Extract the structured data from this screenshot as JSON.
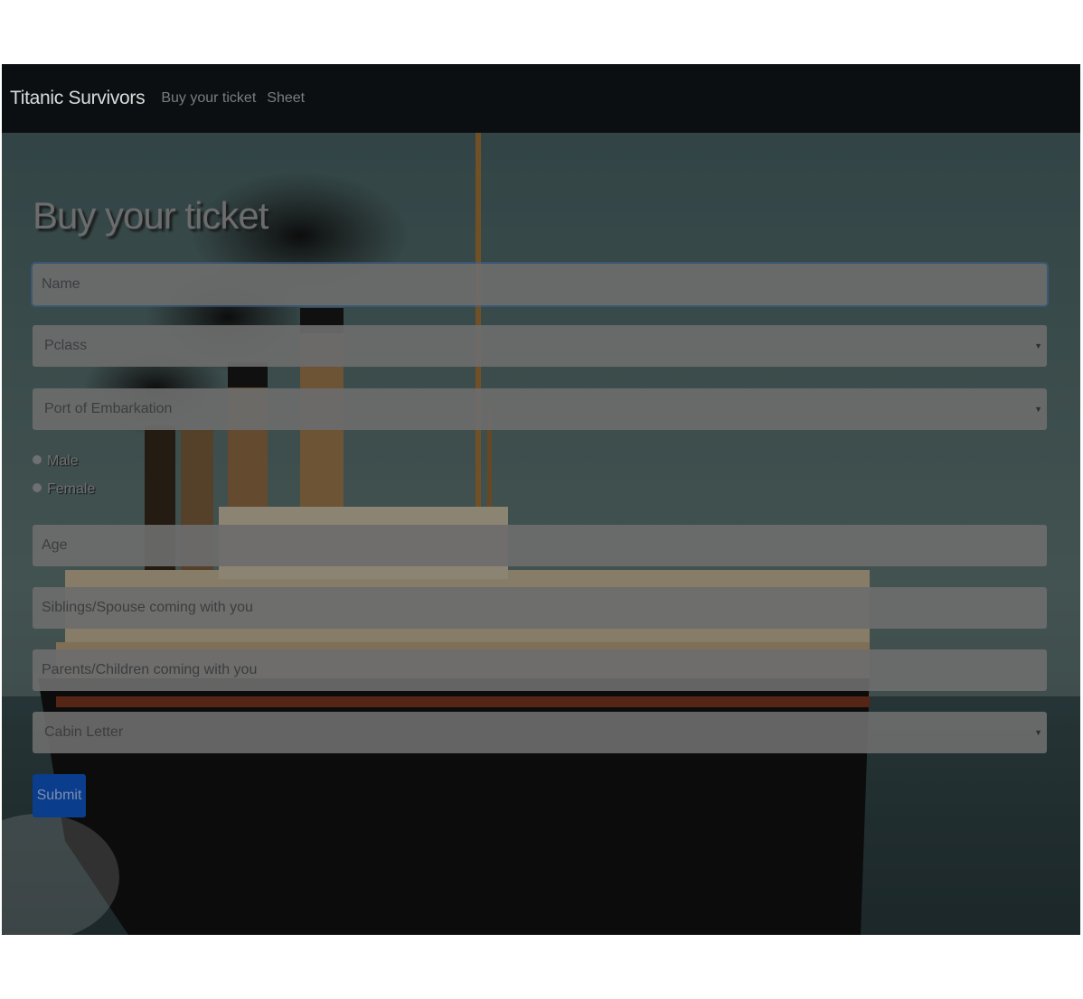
{
  "navbar": {
    "brand": "Titanic Survivors",
    "links": [
      "Buy your ticket",
      "Sheet"
    ]
  },
  "page": {
    "title": "Buy your ticket"
  },
  "form": {
    "name_placeholder": "Name",
    "pclass_selected": "Pclass",
    "embark_selected": "Port of Embarkation",
    "sex_options": [
      "Male",
      "Female"
    ],
    "age_placeholder": "Age",
    "sibsp_placeholder": "Siblings/Spouse coming with you",
    "parch_placeholder": "Parents/Children coming with you",
    "cabin_selected": "Cabin Letter",
    "submit_label": "Submit"
  },
  "icons": {
    "select_caret": "chevron-down-icon"
  },
  "colors": {
    "navbar_bg": "#0c0f11",
    "field_bg": "#6c6c6c",
    "submit_bg": "#0a3d8c"
  }
}
